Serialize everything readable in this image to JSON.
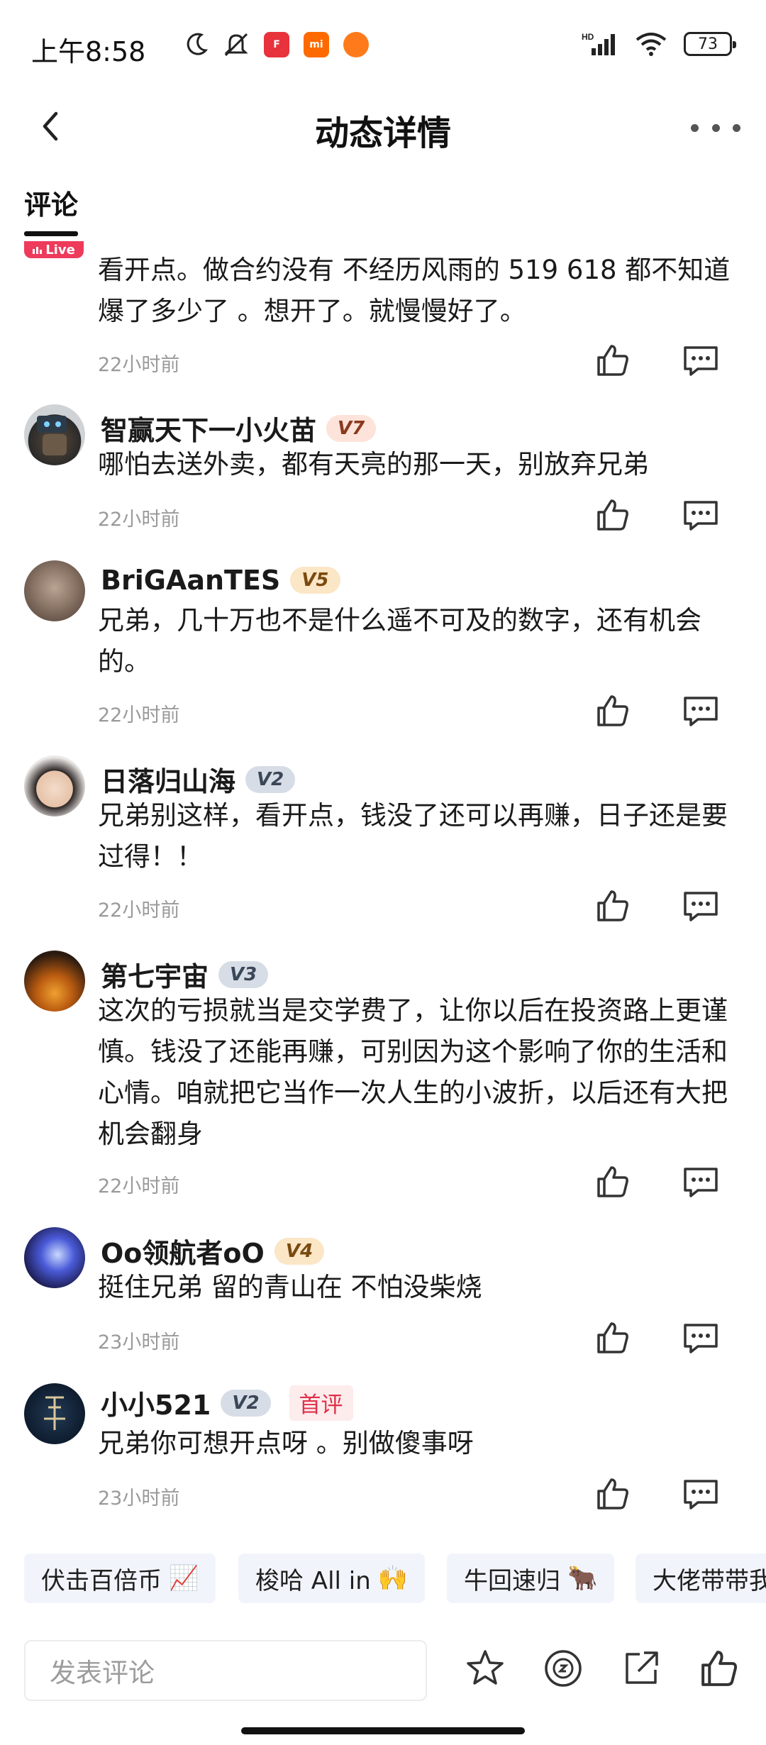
{
  "status_bar": {
    "time": "上午8:58",
    "battery": "73",
    "network": "HD"
  },
  "header": {
    "title": "动态详情"
  },
  "tab": {
    "label": "评论"
  },
  "live_badge": "Live",
  "comments": [
    {
      "text": "看开点。做合约没有 不经历风雨的  519  618   都不知道爆了多少了 。想开了。就慢慢好了。",
      "time": "22小时前"
    },
    {
      "name": "智赢天下一小火苗",
      "level": "V7",
      "text": "哪怕去送外卖，都有天亮的那一天，别放弃兄弟",
      "time": "22小时前"
    },
    {
      "name": "BriGAanTES",
      "level": "V5",
      "text": "兄弟，几十万也不是什么遥不可及的数字，还有机会的。",
      "time": "22小时前"
    },
    {
      "name": "日落归山海",
      "level": "V2",
      "text": "兄弟别这样，看开点，钱没了还可以再赚，日子还是要过得！！",
      "time": "22小时前"
    },
    {
      "name": "第七宇宙",
      "level": "V3",
      "text": "这次的亏损就当是交学费了，让你以后在投资路上更谨慎。钱没了还能再赚，可别因为这个影响了你的生活和心情。咱就把它当作一次人生的小波折，以后还有大把机会翻身",
      "time": "22小时前"
    },
    {
      "name": "Oo领航者oO",
      "level": "V4",
      "text": "挺住兄弟 留的青山在 不怕没柴烧",
      "time": "23小时前"
    },
    {
      "name": "小小521",
      "level": "V2",
      "badge": "首评",
      "text": "兄弟你可想开点呀 。别做傻事呀",
      "time": "23小时前"
    }
  ],
  "quick_replies": [
    {
      "label": "伏击百倍币",
      "emoji": "📈"
    },
    {
      "label": "梭哈 All in",
      "emoji": "🙌"
    },
    {
      "label": "牛回速归",
      "emoji": "🐂"
    },
    {
      "label": "大佬带带我",
      "emoji": ""
    }
  ],
  "bottom_bar": {
    "placeholder": "发表评论"
  },
  "colors": {
    "accent_red": "#e0304a",
    "muted_text": "#9a9a9a",
    "chip_bg": "#f1f5fb"
  }
}
